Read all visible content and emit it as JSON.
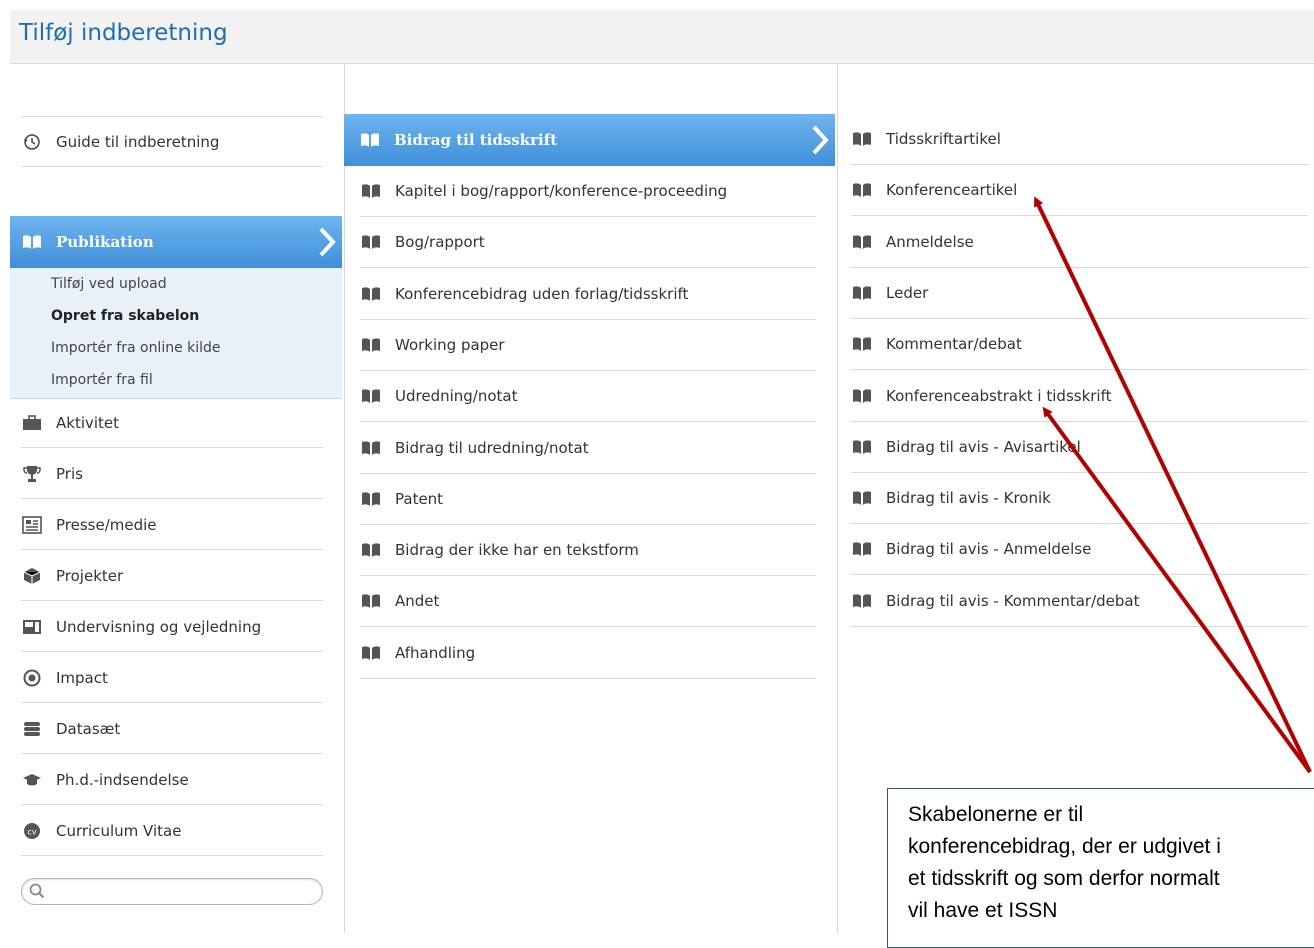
{
  "header": {
    "title": "Tilføj indberetning"
  },
  "left": {
    "guide": "Guide til indberetning",
    "publikation": "Publikation",
    "sub": [
      "Tilføj ved upload",
      "Opret fra skabelon",
      "Importér fra online kilde",
      "Importér fra fil"
    ],
    "items": [
      {
        "label": "Aktivitet",
        "icon": "briefcase-icon"
      },
      {
        "label": "Pris",
        "icon": "trophy-icon"
      },
      {
        "label": "Presse/medie",
        "icon": "newspaper-icon"
      },
      {
        "label": "Projekter",
        "icon": "box-icon"
      },
      {
        "label": "Undervisning og vejledning",
        "icon": "presentation-icon"
      },
      {
        "label": "Impact",
        "icon": "target-icon"
      },
      {
        "label": "Datasæt",
        "icon": "database-icon"
      },
      {
        "label": "Ph.d.-indsendelse",
        "icon": "graduation-cap-icon"
      },
      {
        "label": "Curriculum Vitae",
        "icon": "cv-icon"
      }
    ],
    "search_placeholder": ""
  },
  "middle": {
    "active": "Bidrag til tidsskrift",
    "items": [
      "Kapitel i bog/rapport/konference-proceeding",
      "Bog/rapport",
      "Konferencebidrag uden forlag/tidsskrift",
      "Working paper",
      "Udredning/notat",
      "Bidrag til udredning/notat",
      "Patent",
      "Bidrag der ikke har en tekstform",
      "Andet",
      "Afhandling"
    ]
  },
  "right": {
    "items": [
      "Tidsskriftartikel",
      "Konferenceartikel",
      "Anmeldelse",
      "Leder",
      "Kommentar/debat",
      "Konferenceabstrakt i tidsskrift",
      "Bidrag til avis - Avisartikel",
      "Bidrag til avis - Kronik",
      "Bidrag til avis - Anmeldelse",
      "Bidrag til avis - Kommentar/debat"
    ]
  },
  "annotation": {
    "lines": [
      "Skabelonerne er til",
      "konferencebidrag, der er udgivet i",
      "et tidsskrift og som derfor normalt",
      "vil have et ISSN"
    ],
    "arrow_color": "#b30000"
  }
}
